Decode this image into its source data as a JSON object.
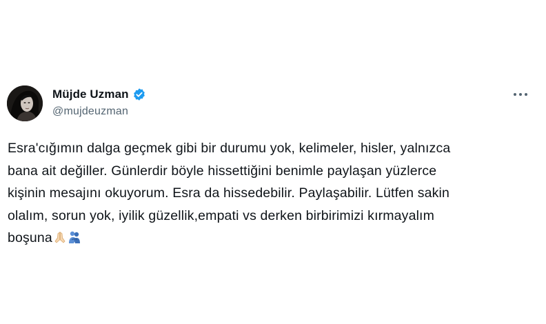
{
  "tweet": {
    "author": {
      "display_name": "Müjde Uzman",
      "handle": "@mujdeuzman",
      "verified": true
    },
    "text_lines": [
      "Esra'cığımın dalga geçmek gibi bir durumu yok, kelimeler, hisler, yalnızca",
      "bana ait değiller. Günlerdir böyle hissettiğini benimle paylaşan yüzlerce",
      "kişinin mesajını okuyorum. Esra da hissedebilir. Paylaşabilir. Lütfen sakin",
      "olalım, sorun yok, iyilik güzellik,empati vs derken birbirimizi kırmayalım",
      "boşuna"
    ],
    "emojis": [
      "folded-hands-icon",
      "people-hugging-icon"
    ],
    "colors": {
      "text": "#0f1419",
      "secondary": "#536471",
      "verified_badge": "#1d9bf0"
    }
  }
}
